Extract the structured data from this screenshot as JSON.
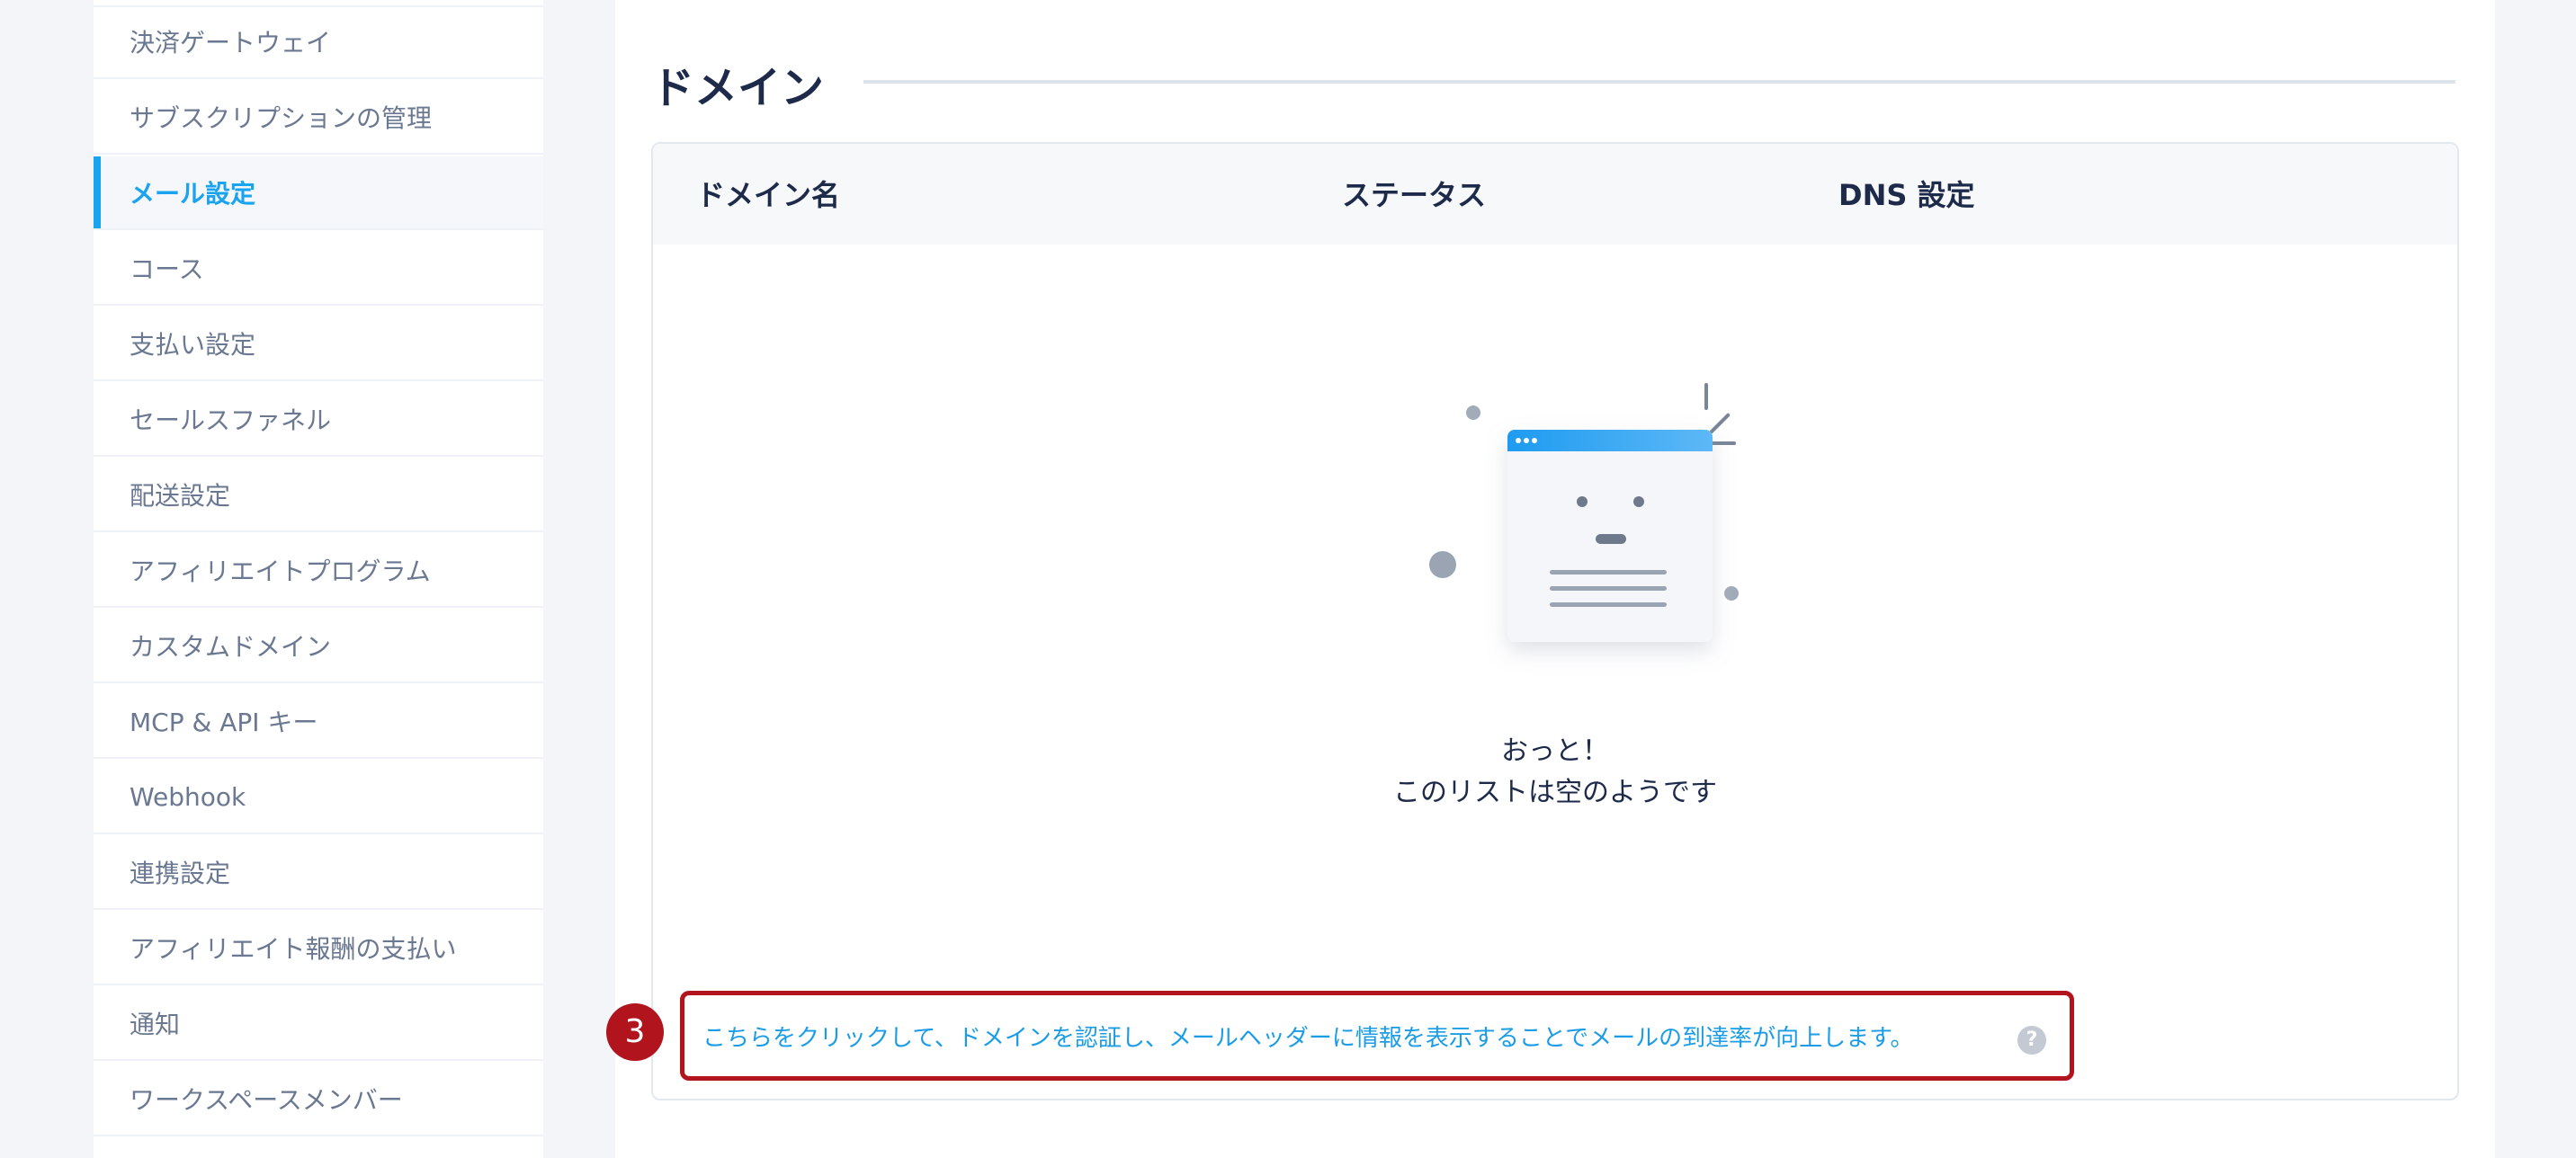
{
  "sidebar": {
    "items": [
      {
        "label": "決済ゲートウェイ",
        "active": false
      },
      {
        "label": "サブスクリプションの管理",
        "active": false
      },
      {
        "label": "メール設定",
        "active": true
      },
      {
        "label": "コース",
        "active": false
      },
      {
        "label": "支払い設定",
        "active": false
      },
      {
        "label": "セールスファネル",
        "active": false
      },
      {
        "label": "配送設定",
        "active": false
      },
      {
        "label": "アフィリエイトプログラム",
        "active": false
      },
      {
        "label": "カスタムドメイン",
        "active": false
      },
      {
        "label": "MCP & API キー",
        "active": false
      },
      {
        "label": "Webhook",
        "active": false
      },
      {
        "label": "連携設定",
        "active": false
      },
      {
        "label": "アフィリエイト報酬の支払い",
        "active": false
      },
      {
        "label": "通知",
        "active": false
      },
      {
        "label": "ワークスペースメンバー",
        "active": false
      }
    ]
  },
  "main": {
    "title": "ドメイン",
    "table": {
      "columns": [
        "ドメイン名",
        "ステータス",
        "DNS 設定"
      ]
    },
    "empty": {
      "line1": "おっと！",
      "line2": "このリストは空のようです"
    },
    "help_link": "こちらをクリックして、ドメインを認証し、メールヘッダーに情報を表示することでメールの到達率が向上します。",
    "help_icon": "?",
    "step_badge": "3"
  },
  "colors": {
    "accent": "#1aa3ee",
    "highlight": "#b2141d"
  }
}
